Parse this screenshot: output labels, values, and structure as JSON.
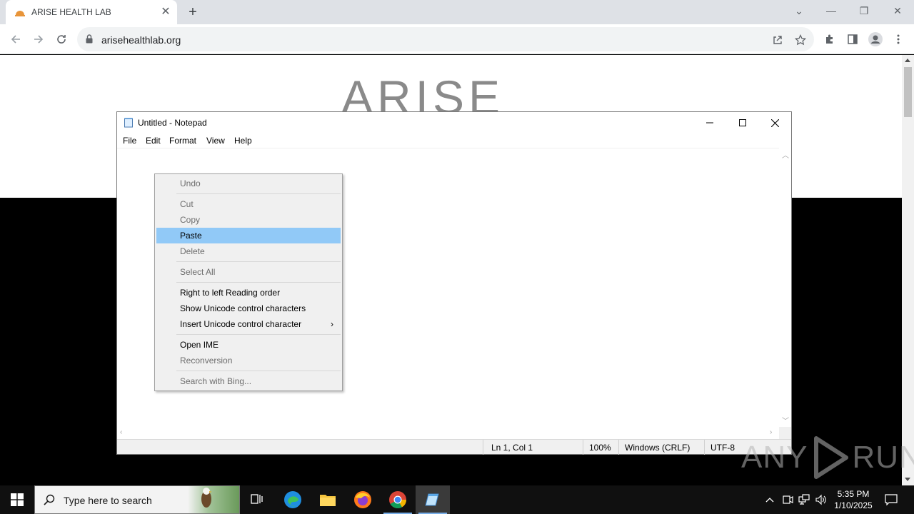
{
  "browser": {
    "tab": {
      "title": "ARISE HEALTH LAB",
      "favicon": "arise-sun-icon"
    },
    "address": {
      "url": "arisehealthlab.org"
    },
    "page": {
      "logo_text": "ARISE"
    }
  },
  "notepad": {
    "title": "Untitled - Notepad",
    "menu": [
      "File",
      "Edit",
      "Format",
      "View",
      "Help"
    ],
    "status": {
      "position": "Ln 1, Col 1",
      "zoom": "100%",
      "line_ending": "Windows (CRLF)",
      "encoding": "UTF-8"
    }
  },
  "context_menu": {
    "items": [
      {
        "label": "Undo",
        "enabled": false
      },
      {
        "label": "Cut",
        "enabled": false
      },
      {
        "label": "Copy",
        "enabled": false
      },
      {
        "label": "Paste",
        "enabled": true,
        "highlighted": true
      },
      {
        "label": "Delete",
        "enabled": false
      },
      {
        "label": "Select All",
        "enabled": false
      },
      {
        "label": "Right to left Reading order",
        "enabled": true
      },
      {
        "label": "Show Unicode control characters",
        "enabled": true
      },
      {
        "label": "Insert Unicode control character",
        "enabled": true,
        "submenu": true
      },
      {
        "label": "Open IME",
        "enabled": true
      },
      {
        "label": "Reconversion",
        "enabled": false
      },
      {
        "label": "Search with Bing...",
        "enabled": false
      }
    ]
  },
  "taskbar": {
    "search_placeholder": "Type here to search",
    "apps": [
      "task-view",
      "edge",
      "file-explorer",
      "firefox",
      "chrome",
      "notepad"
    ],
    "clock": {
      "time": "5:35 PM",
      "date": "1/10/2025"
    }
  },
  "watermark": {
    "text_left": "ANY",
    "text_right": "RUN"
  },
  "colors": {
    "highlight": "#91c9f7",
    "tabstrip": "#dee1e6",
    "taskbar": "#101010"
  }
}
